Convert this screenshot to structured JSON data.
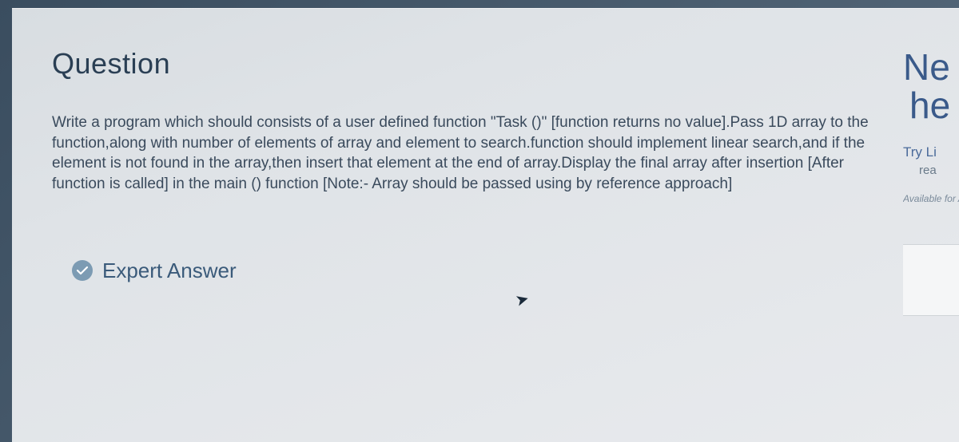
{
  "question": {
    "title": "Question",
    "body": "Write a program which should consists of a user defined function \"Task ()\" [function returns no value].Pass 1D array to the function,along with number of elements of array and element to search.function should implement linear search,and if the element is not found in the array,then insert that element at the end of array.Display the final array after insertion [After function is called] in the main () function [Note:- Array should be passed using by reference approach]"
  },
  "expert": {
    "label": "Expert Answer"
  },
  "sidebar": {
    "heading_line1": "Ne",
    "heading_line2": "he",
    "try_label": "Try Li",
    "rea_label": "rea",
    "available_label": "Available for A"
  }
}
